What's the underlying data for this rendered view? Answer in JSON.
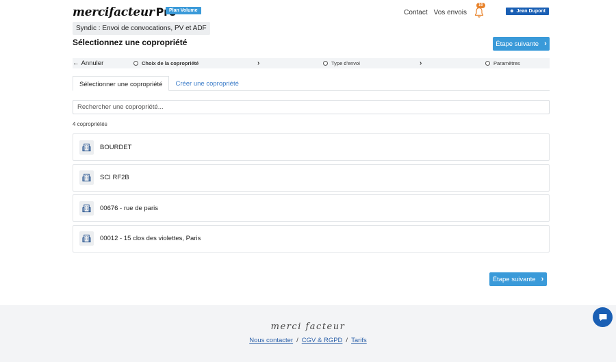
{
  "header": {
    "logo_main": "mercifacteur",
    "logo_suffix": "Pro",
    "plan_badge": "Plan Volume",
    "nav": {
      "contact": "Contact",
      "envois": "Vos envois"
    },
    "notifications_count": "10",
    "user_name": "Jean Dupont"
  },
  "doc_type": "Syndic : Envoi de convocations, PV et ADF",
  "page_title": "Sélectionnez une copropriété",
  "next_button": "Étape suivante",
  "stepper": {
    "cancel": "Annuler",
    "steps": [
      {
        "label": "Choix de la copropriété",
        "active": true
      },
      {
        "label": "Type d'envoi",
        "active": false
      },
      {
        "label": "Paramètres",
        "active": false
      }
    ]
  },
  "tabs": [
    {
      "label": "Sélectionner une copropriété",
      "active": true
    },
    {
      "label": "Créer une copropriété",
      "active": false
    }
  ],
  "search": {
    "placeholder": "Rechercher une copropriété...",
    "value": ""
  },
  "count_text": "4 copropriétés",
  "coproprietes": [
    {
      "name": "BOURDET"
    },
    {
      "name": "SCI RF2B"
    },
    {
      "name": "00676 - rue de paris"
    },
    {
      "name": "00012 - 15 clos des violettes, Paris"
    }
  ],
  "footer": {
    "logo": "merci facteur",
    "links": {
      "contact": "Nous contacter",
      "cgv": "CGV & RGPD",
      "tarifs": "Tarifs"
    },
    "separator": "/"
  },
  "colors": {
    "accent": "#3a9ad9",
    "user_badge": "#1a5fb4",
    "notification": "#e8822a",
    "footer_bg": "#f3f4f6"
  }
}
